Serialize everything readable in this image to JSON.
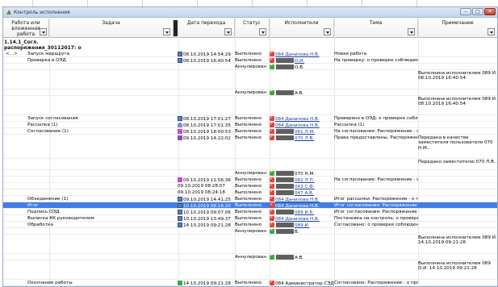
{
  "window": {
    "title": "Контроль исполнения"
  },
  "columns": {
    "work": "Работа или вложенная работа",
    "task": "Задача",
    "date": "Дата перехода",
    "status": "Статус",
    "executors": "Исполнители",
    "topic": "Тема",
    "note": "Примечание"
  },
  "group": {
    "line1": "1.14.1_Согл.",
    "line2": "распоряжения_30112017: о"
  },
  "rows": [
    {
      "work": "<...>",
      "task": "Запуск маршрута",
      "icon": "doc-icon",
      "date": "08.10.2019 14:54:29",
      "status": "Выполнено",
      "exec_icon": "check-icon",
      "exec": "084 Данилова Н.В.",
      "exec_link": true,
      "topic": "Новая работа",
      "note": ""
    },
    {
      "work": "",
      "task": "Проверка в ОЭД",
      "icon": "doc-icon",
      "date": "08.10.2019 16:40:54",
      "status": "Выполнено",
      "exec_icon": "check-icon",
      "exec": "О.И.",
      "exec_link": true,
      "topic": "На проверку: о проверке соблюден",
      "note": ""
    },
    {
      "work": "",
      "task": "",
      "icon": "",
      "date": "",
      "status": "Аннулирован",
      "exec_icon": "cancel-icon",
      "exec": "О.В.",
      "exec_link": false,
      "topic": "",
      "note": ""
    },
    {
      "work": "",
      "task": "",
      "icon": "",
      "date": "",
      "status": "",
      "exec_icon": "",
      "exec": "",
      "exec_link": false,
      "topic": "",
      "note": "Выполнена исполнителем 089 И. 08.10.2019 16:40:54"
    },
    {
      "work": "",
      "task": "",
      "icon": "",
      "date": "",
      "status": "Аннулирован",
      "exec_icon": "cancel-icon",
      "exec": "А.В.",
      "exec_link": false,
      "topic": "",
      "note": ""
    },
    {
      "work": "",
      "task": "",
      "icon": "",
      "date": "",
      "status": "",
      "exec_icon": "",
      "exec": "",
      "exec_link": false,
      "topic": "",
      "note": "Выполнена исполнителем 089 И. 08.10.2019 16:40:54"
    },
    {
      "work": "",
      "task": "Запуск согласования",
      "icon": "doc-icon",
      "date": "08.10.2019 17:01:27",
      "status": "Выполнено",
      "exec_icon": "check-icon",
      "exec": "084 Данилова Н.В.",
      "exec_link": true,
      "topic": "Проверено в ОЭД: о проверке соблю",
      "note": ""
    },
    {
      "work": "",
      "task": "Рассылка (1)",
      "icon": "person-icon",
      "date": "08.10.2019 17:01:35",
      "status": "Выполнено",
      "exec_icon": "check-icon",
      "exec": "084 Данилова Н.В.",
      "exec_link": true,
      "topic": "Рассылка (1)",
      "note": ""
    },
    {
      "work": "",
      "task": "Согласование (1)",
      "icon": "route-icon",
      "date": "08.10.2019 18:00:53",
      "status": "Выполнено",
      "exec_icon": "check-icon",
      "exec": "061 Л.М.",
      "exec_link": true,
      "topic": "На согласование: Распоряжение - о г",
      "note": ""
    },
    {
      "work": "",
      "task": "",
      "icon": "users-icon",
      "date": "09.10.2019 14:22:02",
      "status": "Выполнено",
      "exec_icon": "check-icon",
      "exec": "070 Л.В.",
      "exec_link": true,
      "topic": "Права предоставлены. Распоряжени",
      "note": "Передана в качестве заместителя пользователя 070 Н.М.."
    },
    {
      "work": "",
      "task": "",
      "icon": "",
      "date": "",
      "status": "",
      "exec_icon": "",
      "exec": "",
      "exec_link": false,
      "topic": "",
      "note": "Передано заместителю 070 Л.В.."
    },
    {
      "work": "",
      "task": "",
      "icon": "",
      "date": "",
      "status": "Аннулирован",
      "exec_icon": "cancel-icon",
      "exec": "070 Н.М.",
      "exec_link": false,
      "topic": "",
      "note": ""
    },
    {
      "work": "",
      "task": "",
      "icon": "route-icon",
      "date": "09.10.2019 11:56:36",
      "status": "Выполнено",
      "exec_icon": "check-icon",
      "exec": "082 Л.П.",
      "exec_link": true,
      "topic": "На согласование: Распоряжение - о г",
      "note": ""
    },
    {
      "work": "",
      "task": "",
      "icon": "",
      "date": "09.10.2019 08:28:07",
      "status": "Выполнено",
      "exec_icon": "check-icon",
      "exec": "043 С.Ф.",
      "exec_link": true,
      "topic": "",
      "note": ""
    },
    {
      "work": "",
      "task": "",
      "icon": "",
      "date": "09.10.2019 08:24:18",
      "status": "Выполнено",
      "exec_icon": "check-icon",
      "exec": "047 А.В.",
      "exec_link": true,
      "topic": "",
      "note": ""
    },
    {
      "work": "",
      "task": "Объединение (1)",
      "icon": "doc-icon",
      "date": "09.10.2019 14:41:25",
      "status": "Выполнено",
      "exec_icon": "check-icon",
      "exec": "084 Данилова Н.В.",
      "exec_link": true,
      "topic": "Итог рассылки: Распоряжение - о пр",
      "note": ""
    },
    {
      "work": "",
      "task": "Итог",
      "icon": "doc-icon",
      "date": "10.10.2019 08:16:20",
      "status": "Выполнено",
      "exec_icon": "check-icon",
      "exec": "084 Данилова Н.В.",
      "exec_link": true,
      "topic": "Итог согласования: Распоряжение -",
      "note": "",
      "selected": true
    },
    {
      "work": "",
      "task": "Подпись ОЭД",
      "icon": "doc-icon",
      "date": "10.10.2019 09:07:06",
      "status": "Выполнено",
      "exec_icon": "check-icon",
      "exec": "089 И.Б.",
      "exec_link": true,
      "topic": "Итог согласования: Распоряжение -",
      "note": ""
    },
    {
      "work": "",
      "task": "Выписка КК руководителем",
      "icon": "doc-icon",
      "date": "10.10.2019 13:49:37",
      "status": "Выполнено",
      "exec_icon": "check-icon",
      "exec": "084 Данилова Н.В.",
      "exec_link": true,
      "topic": "Постановка на контроль: о проверк",
      "note": ""
    },
    {
      "work": "",
      "task": "Обработка",
      "icon": "doc-icon",
      "date": "14.10.2019 09:21:28",
      "status": "Выполнено",
      "exec_icon": "check-icon",
      "exec": "089 И.",
      "exec_link": true,
      "topic": "Согласовано: о проверке соблюден",
      "note": ""
    },
    {
      "work": "",
      "task": "",
      "icon": "",
      "date": "",
      "status": "Аннулирован",
      "exec_icon": "cancel-icon",
      "exec": "В.",
      "exec_link": false,
      "topic": "",
      "note": ""
    },
    {
      "work": "",
      "task": "",
      "icon": "",
      "date": "",
      "status": "",
      "exec_icon": "",
      "exec": "",
      "exec_link": false,
      "topic": "",
      "note": "Выполнена исполнителем 089 И. 14.10.2019 09:21:28"
    },
    {
      "work": "",
      "task": "",
      "icon": "",
      "date": "",
      "status": "Аннулирован",
      "exec_icon": "cancel-icon",
      "exec": "А.В.",
      "exec_link": false,
      "topic": "",
      "note": ""
    },
    {
      "work": "",
      "task": "",
      "icon": "",
      "date": "",
      "status": "",
      "exec_icon": "",
      "exec": "",
      "exec_link": false,
      "topic": "",
      "note": "Выполнена исполнителем 089 О.И. 14.10.2019 09:21:28"
    },
    {
      "work": "",
      "task": "Окончание работы",
      "icon": "finish-icon",
      "date": "14.10.2019 09:21:28",
      "status": "Выполнено",
      "exec_icon": "check-icon",
      "exec": "084 Администратор СЭД",
      "exec_link": false,
      "topic": "Согласовано: Распоряжение - о пров",
      "note": ""
    }
  ]
}
